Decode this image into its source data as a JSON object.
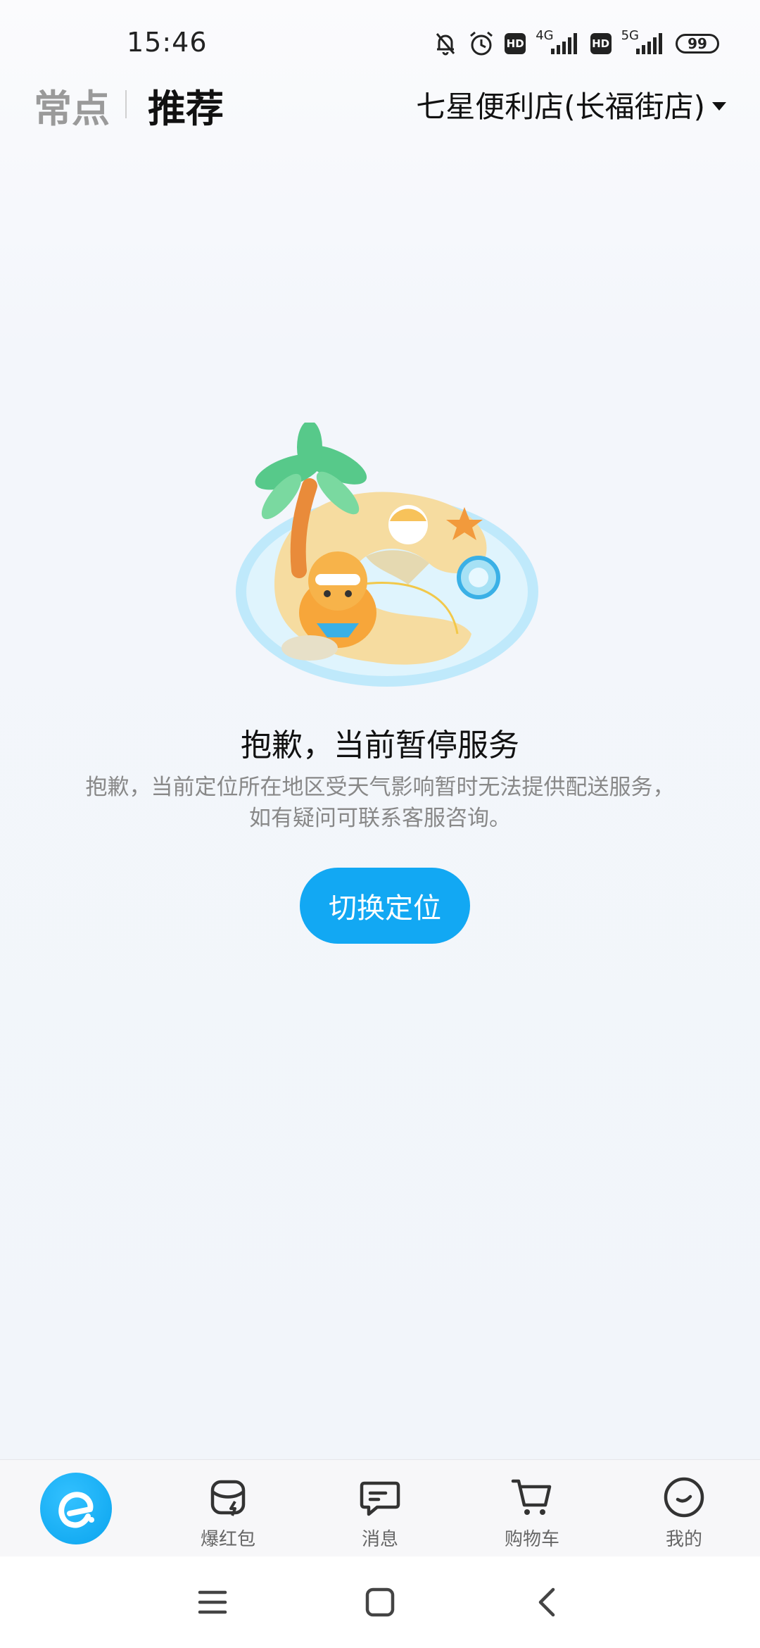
{
  "status_bar": {
    "time": "15:46",
    "icons": [
      "mute-bell-icon",
      "alarm-icon",
      "hd-icon",
      "signal-4g-icon",
      "hd-icon",
      "signal-5g-icon",
      "battery-icon"
    ],
    "net1": "4G",
    "net2": "5G",
    "hd": "HD",
    "battery": "99"
  },
  "header": {
    "tab_common": "常点",
    "tab_recommend": "推荐",
    "store_name": "七星便利店(长福街店)"
  },
  "message": {
    "title": "抱歉，当前暂停服务",
    "description": "抱歉，当前定位所在地区受天气影响暂时无法提供配送服务，如有疑问可联系客服咨询。",
    "button": "切换定位"
  },
  "bottom_nav": {
    "items": [
      {
        "label": "",
        "icon": "eleme-logo-icon"
      },
      {
        "label": "爆红包",
        "icon": "red-packet-icon"
      },
      {
        "label": "消息",
        "icon": "message-icon"
      },
      {
        "label": "购物车",
        "icon": "cart-icon"
      },
      {
        "label": "我的",
        "icon": "profile-icon"
      }
    ]
  },
  "colors": {
    "accent": "#12a8f3",
    "text_primary": "#111111",
    "text_secondary": "#888888"
  }
}
